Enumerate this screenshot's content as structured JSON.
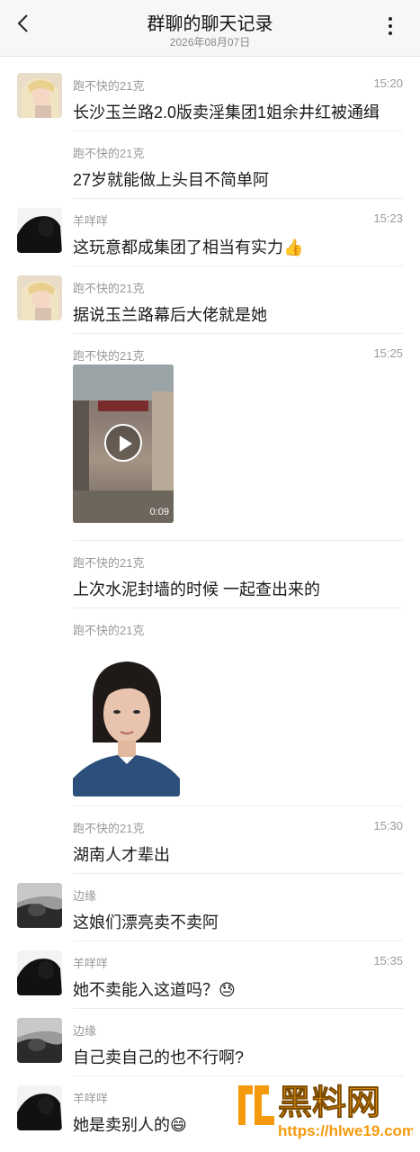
{
  "header": {
    "title": "群聊的聊天记录",
    "date": "2026年08月07日"
  },
  "messages": [
    {
      "sender": "跑不快的21克",
      "time": "15:20",
      "text": "长沙玉兰路2.0版卖淫集团1姐余井红被通缉"
    },
    {
      "sender": "跑不快的21克",
      "time": "",
      "text": "27岁就能做上头目不简单阿"
    },
    {
      "sender": "羊咩咩",
      "time": "15:23",
      "text": "这玩意都成集团了相当有实力👍"
    },
    {
      "sender": "跑不快的21克",
      "time": "",
      "text": "据说玉兰路幕后大佬就是她"
    },
    {
      "sender": "跑不快的21克",
      "time": "15:25",
      "video_duration": "0:09"
    },
    {
      "sender": "跑不快的21克",
      "time": "",
      "text": "上次水泥封墙的时候 一起查出来的"
    },
    {
      "sender": "跑不快的21克",
      "time": ""
    },
    {
      "sender": "跑不快的21克",
      "time": "15:30",
      "text": "湖南人才辈出"
    },
    {
      "sender": "边缘",
      "time": "",
      "text": "这娘们漂亮卖不卖阿"
    },
    {
      "sender": "羊咩咩",
      "time": "15:35",
      "text": "她不卖能入这道吗？😓"
    },
    {
      "sender": "边缘",
      "time": "",
      "text": "自己卖自己的也不行啊?"
    },
    {
      "sender": "羊咩咩",
      "time": "",
      "text": "她是卖别人的😄"
    }
  ],
  "watermark": {
    "brand": "黑料网",
    "url": "https://hlwe19.com"
  },
  "colors": {
    "accent_orange": "#f59a0c",
    "text_primary": "#1a1a1a",
    "text_secondary": "#999999"
  }
}
